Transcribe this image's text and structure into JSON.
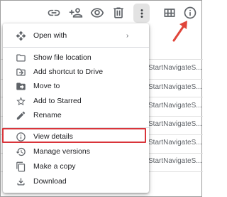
{
  "toolbar": {
    "icons": [
      "link-icon",
      "add-person-icon",
      "preview-eye-icon",
      "trash-icon",
      "more-vert-icon",
      "grid-view-icon",
      "info-icon"
    ]
  },
  "background_rows": [
    "StartNavigateS...",
    "StartNavigateS...",
    "StartNavigateS...",
    "StartNavigateS...",
    "StartNavigateS...",
    "StartNavigateS..."
  ],
  "menu": {
    "open_with": "Open with",
    "show_file_location": "Show file location",
    "add_shortcut": "Add shortcut to Drive",
    "move_to": "Move to",
    "add_starred": "Add to Starred",
    "rename": "Rename",
    "view_details": "View details",
    "manage_versions": "Manage versions",
    "make_copy": "Make a copy",
    "download": "Download"
  },
  "colors": {
    "highlight_border": "#d9343a",
    "arrow": "#e0453a",
    "icon": "#5f6368"
  }
}
